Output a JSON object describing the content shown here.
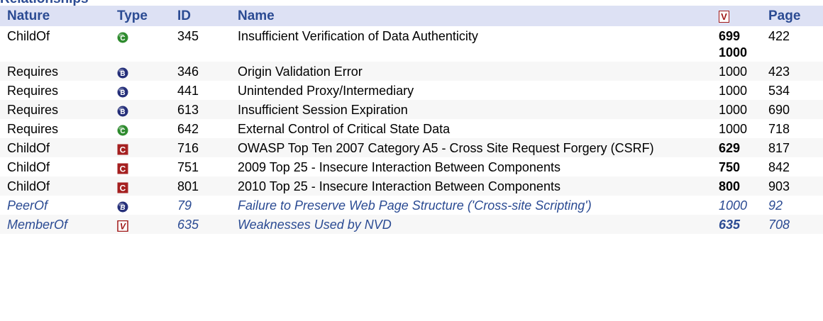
{
  "section_title": "Relationships",
  "headers": {
    "nature": "Nature",
    "type": "Type",
    "id": "ID",
    "name": "Name",
    "view_symbol": "V",
    "page": "Page"
  },
  "rows": [
    {
      "nature": "ChildOf",
      "type_icon": "class-icon",
      "type_letter": "C",
      "id": "345",
      "name": "Insufficient Verification of Data Authenticity",
      "views": [
        "699",
        "1000"
      ],
      "views_bold": [
        true,
        true
      ],
      "page": "422",
      "italic": false
    },
    {
      "nature": "Requires",
      "type_icon": "base-icon",
      "type_letter": "B",
      "id": "346",
      "name": "Origin Validation Error",
      "views": [
        "1000"
      ],
      "views_bold": [
        false
      ],
      "page": "423",
      "italic": false
    },
    {
      "nature": "Requires",
      "type_icon": "base-icon",
      "type_letter": "B",
      "id": "441",
      "name": "Unintended Proxy/Intermediary",
      "views": [
        "1000"
      ],
      "views_bold": [
        false
      ],
      "page": "534",
      "italic": false
    },
    {
      "nature": "Requires",
      "type_icon": "base-icon",
      "type_letter": "B",
      "id": "613",
      "name": "Insufficient Session Expiration",
      "views": [
        "1000"
      ],
      "views_bold": [
        false
      ],
      "page": "690",
      "italic": false
    },
    {
      "nature": "Requires",
      "type_icon": "class-icon",
      "type_letter": "C",
      "id": "642",
      "name": "External Control of Critical State Data",
      "views": [
        "1000"
      ],
      "views_bold": [
        false
      ],
      "page": "718",
      "italic": false
    },
    {
      "nature": "ChildOf",
      "type_icon": "category-icon",
      "type_letter": "C",
      "id": "716",
      "name": "OWASP Top Ten 2007 Category A5 - Cross Site Request Forgery (CSRF)",
      "views": [
        "629"
      ],
      "views_bold": [
        true
      ],
      "page": "817",
      "italic": false
    },
    {
      "nature": "ChildOf",
      "type_icon": "category-icon",
      "type_letter": "C",
      "id": "751",
      "name": "2009 Top 25 - Insecure Interaction Between Components",
      "views": [
        "750"
      ],
      "views_bold": [
        true
      ],
      "page": "842",
      "italic": false
    },
    {
      "nature": "ChildOf",
      "type_icon": "category-icon",
      "type_letter": "C",
      "id": "801",
      "name": "2010 Top 25 - Insecure Interaction Between Components",
      "views": [
        "800"
      ],
      "views_bold": [
        true
      ],
      "page": "903",
      "italic": false
    },
    {
      "nature": "PeerOf",
      "type_icon": "base-icon",
      "type_letter": "B",
      "id": "79",
      "name": "Failure to Preserve Web Page Structure ('Cross-site Scripting')",
      "views": [
        "1000"
      ],
      "views_bold": [
        false
      ],
      "page": "92",
      "italic": true
    },
    {
      "nature": "MemberOf",
      "type_icon": "view-icon",
      "type_letter": "V",
      "id": "635",
      "name": "Weaknesses Used by NVD",
      "views": [
        "635"
      ],
      "views_bold": [
        true
      ],
      "page": "708",
      "italic": true
    }
  ],
  "colors": {
    "header_text": "#2b4b93",
    "header_bg": "#dde1f4",
    "class_icon": "#2e8b2e",
    "base_icon": "#26307a",
    "category_icon": "#a52020",
    "view_icon": "#a01818"
  }
}
